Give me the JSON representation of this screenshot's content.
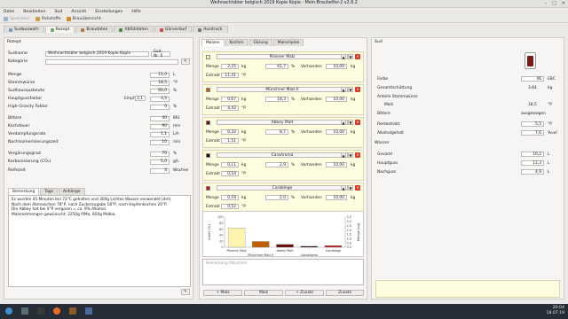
{
  "window": {
    "title": "Weihnachtsbier belgisch 2019 Kopie Kopie - Mein-Brauhelfer-2 v2.6.2"
  },
  "menu": [
    "Datei",
    "Bearbeiten",
    "Sud",
    "Ansicht",
    "Einstellungen",
    "Hilfe"
  ],
  "toolbar": {
    "save": "Speichern",
    "raw": "Rohstoffe",
    "browser": "Brauübersicht"
  },
  "tabs": [
    "Sudauswahl",
    "Rezept",
    "Braudaten",
    "Abfülldaten",
    "Gärverlauf",
    "Ausdruck"
  ],
  "recipe": {
    "header": "Rezept",
    "sudname_label": "Sudname",
    "sudname": "Weihnachtsbier belgisch 2019 Kopie Kopie",
    "sudnr": "Sud-Nr. 0",
    "kategorie_label": "Kategorie",
    "fields": [
      {
        "label": "Menge",
        "value": "11,0",
        "unit": "L"
      },
      {
        "label": "Stammwürze",
        "value": "18,5",
        "unit": "°P"
      },
      {
        "label": "Sudhausausbeute",
        "value": "60,0",
        "unit": "%"
      },
      {
        "label": "Hauptgussfaktor",
        "value": "3,5",
        "unit": ""
      },
      {
        "label": "High-Gravity Faktor",
        "value": "0",
        "unit": "%"
      },
      {
        "label": "Bittere",
        "value": "40",
        "unit": "IBU"
      },
      {
        "label": "Kochdauer",
        "value": "90",
        "unit": "min"
      },
      {
        "label": "Verdampfungsrate",
        "value": "1,1",
        "unit": "L/h"
      },
      {
        "label": "Nachisomerisierungszeit",
        "value": "10",
        "unit": "min"
      },
      {
        "label": "Vergärungsgrad",
        "value": "70",
        "unit": "%"
      },
      {
        "label": "Karbonisierung (CO₂)",
        "value": "5,0",
        "unit": "g/L"
      },
      {
        "label": "Reifezeit",
        "value": "4",
        "unit": "Wochen"
      }
    ],
    "empf_label": "Empf.",
    "empf_value": "3,1",
    "note_tabs": [
      "Bemerkung",
      "Tags",
      "Anhänge"
    ],
    "note_lines": [
      "Es wurden 45 Minuten bei 72°C gehalten und 300g Lichtes Wasser verwendet (dm).",
      "Nach dem Abmaischen 78°P, nach Zuckerzugabe 18°P, nach Hopfenkochen 20°P.",
      "Die Abbey hat bei 4°P vergoren = ca. 9% Alkohol.",
      "Malzrestmengen gewünscht: 2250g PiMa, 850g Mdbla."
    ]
  },
  "grain": {
    "tabs": [
      "Malzen",
      "Kochen",
      "Gärung",
      "Maischplan"
    ],
    "items": [
      {
        "name": "Pilsener Malz",
        "color": "#fff3b0",
        "menge": "2,25",
        "prozent": "61,7",
        "vorhanden": "10,00",
        "unit": "kg",
        "extrakt": "11,41"
      },
      {
        "name": "Münchner Malz II",
        "color": "#c06000",
        "menge": "0,67",
        "prozent": "18,3",
        "vorhanden": "10,00",
        "unit": "kg",
        "extrakt": "4,42"
      },
      {
        "name": "Abbey Malt",
        "color": "#6a0c0c",
        "menge": "0,32",
        "prozent": "8,7",
        "vorhanden": "10,00",
        "unit": "kg",
        "extrakt": "1,51"
      },
      {
        "name": "CaraAroma",
        "color": "#1a0505",
        "menge": "0,11",
        "prozent": "2,9",
        "vorhanden": "10,00",
        "unit": "kg",
        "extrakt": "0,54"
      },
      {
        "name": "Carablege",
        "color": "#b81818",
        "menge": "0,19",
        "prozent": "2,0",
        "vorhanden": "10,00",
        "unit": "kg",
        "extrakt": "0,52"
      }
    ],
    "labels": {
      "menge": "Menge",
      "extrakt": "Extrakt",
      "vorhanden": "Vorhanden",
      "kg": "kg",
      "pct": "%",
      "sw": "°P"
    },
    "comment_placeholder": "Bemerkung Maischen",
    "buttons": {
      "malz": "+ Malz",
      "malz2": "Malz",
      "zusatz": "+ Zusatz",
      "zusatz2": "Zusatz"
    }
  },
  "chart_data": {
    "type": "bar",
    "categories": [
      "Pilsener Malz",
      "Münchner Malz II",
      "Abbey Malt",
      "CaraAroma",
      "Carablege"
    ],
    "values": [
      2.25,
      0.67,
      0.32,
      0.11,
      0.19
    ],
    "colors": [
      "#fff3b0",
      "#c06000",
      "#6a0c0c",
      "#1a0505",
      "#b81818"
    ],
    "ylabel": "Anteil (%)",
    "ylabel2": "Menge (kg)",
    "ylim": [
      0,
      100
    ],
    "yticks": [
      "100",
      "80",
      "60",
      "40",
      "20",
      "0"
    ],
    "yticks2": [
      "3,5",
      "3,0",
      "2,5",
      "2,0",
      "1,5",
      "1,0",
      "0,5",
      "0,0"
    ]
  },
  "sud": {
    "header": "Sud",
    "farbe_label": "Farbe",
    "farbe": "46",
    "farbe_unit": "EBC",
    "gesamt_label": "Gesamtschüttung",
    "gesamt": "3,64",
    "gesamt_unit": "kg",
    "anteil_label": "Anteile Stammwürze",
    "malz_label": "Malz",
    "malz": "18,5",
    "malz_unit": "°P",
    "bittere_label": "Bittere",
    "bittere": "ausgewogen",
    "restextrakt_label": "Restextrakt",
    "restextrakt": "5,5",
    "restextrakt_unit": "°P",
    "alkohol_label": "Alkoholgehalt",
    "alkohol": "7,6",
    "alkohol_unit": "%vol",
    "wasser_header": "Wasser",
    "gesamt_w_label": "Gesamt",
    "gesamt_w": "16,2",
    "gesamt_w_unit": "L",
    "haupt_label": "Hauptguss",
    "haupt": "11,3",
    "haupt_unit": "L",
    "nach_label": "Nachguss",
    "nach": "4,9",
    "nach_unit": "L",
    "beer_color": "#7a1a14"
  },
  "taskbar": {
    "time": "20:04",
    "date": "18.07.19"
  }
}
